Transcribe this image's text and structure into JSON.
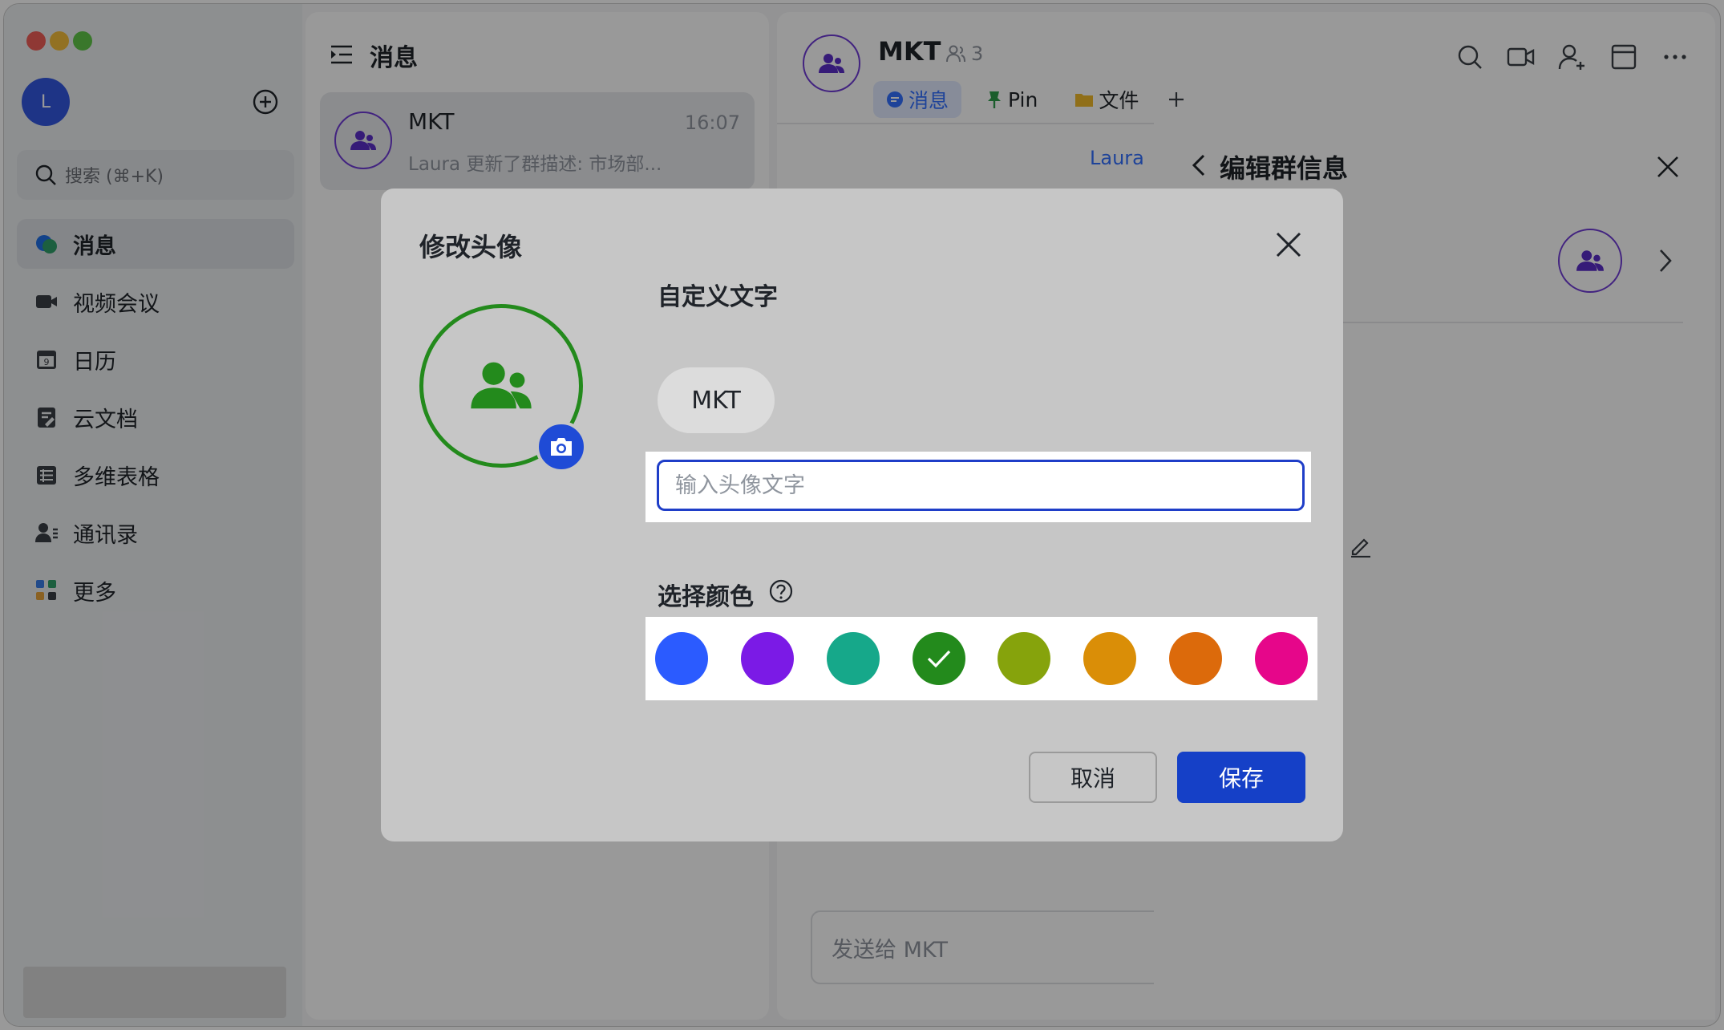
{
  "sidebar": {
    "user_initial": "L",
    "search_placeholder": "搜索 (⌘+K)",
    "nav": [
      "消息",
      "视频会议",
      "日历",
      "云文档",
      "多维表格",
      "通讯录",
      "更多"
    ],
    "active_index": 0,
    "calendar_day": "9"
  },
  "chatlist": {
    "title": "消息",
    "items": [
      {
        "name": "MKT",
        "time": "16:07",
        "preview": "Laura 更新了群描述: 市场部..."
      }
    ]
  },
  "chat": {
    "name": "MKT",
    "member_count": "3",
    "tabs": [
      "消息",
      "Pin",
      "文件"
    ],
    "active_tab_index": 0,
    "sender_name": "Laura",
    "input_placeholder": "发送给 MKT"
  },
  "panel": {
    "title": "编辑群信息"
  },
  "modal": {
    "title": "修改头像",
    "custom_text_label": "自定义文字",
    "current_text": "MKT",
    "text_input_placeholder": "输入头像文字",
    "color_label": "选择颜色",
    "colors": [
      "#2b5bff",
      "#7b1ae6",
      "#16a88a",
      "#238a1c",
      "#86a30c",
      "#da8e07",
      "#dc6a0b",
      "#e6068a"
    ],
    "selected_color_index": 3,
    "cancel_label": "取消",
    "save_label": "保存"
  }
}
